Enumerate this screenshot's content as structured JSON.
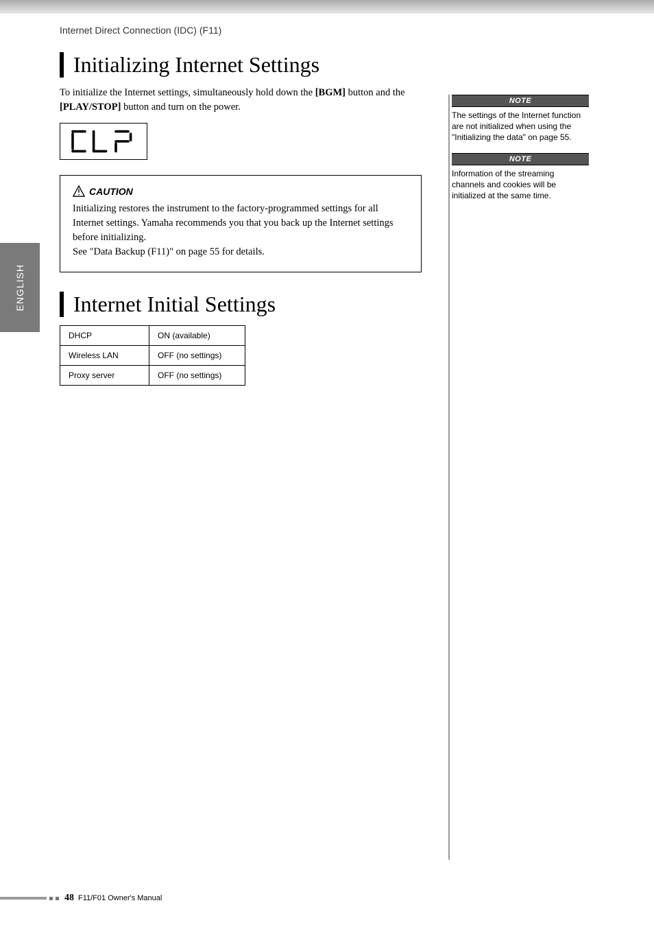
{
  "header": "Internet Direct Connection (IDC) (F11)",
  "side_tab": "ENGLISH",
  "section1": {
    "title": "Initializing Internet Settings",
    "intro_pre": "To initialize the Internet settings, simultaneously hold down the ",
    "intro_btn1": "[BGM]",
    "intro_mid": " button and the ",
    "intro_btn2": "[PLAY/STOP]",
    "intro_post": " button and turn on the power.",
    "lcd": "CLr"
  },
  "caution": {
    "label": "CAUTION",
    "body1": "Initializing restores the instrument to the factory-programmed settings for all Internet settings. Yamaha recommends you that you back up the Internet settings before initializing.",
    "body2": "See  \"Data Backup (F11)\" on page 55 for details."
  },
  "section2": {
    "title": "Internet Initial Settings",
    "rows": [
      {
        "k": "DHCP",
        "v": "ON (available)"
      },
      {
        "k": "Wireless LAN",
        "v": "OFF (no settings)"
      },
      {
        "k": "Proxy server",
        "v": "OFF (no settings)"
      }
    ]
  },
  "notes": [
    {
      "label": "NOTE",
      "body": "The settings of the Internet function are not initialized when using the \"Initializing the data\" on page 55."
    },
    {
      "label": "NOTE",
      "body": "Information of the streaming channels and cookies will be initialized at the same time."
    }
  ],
  "footer": {
    "page": "48",
    "manual": "F11/F01 Owner's Manual"
  }
}
